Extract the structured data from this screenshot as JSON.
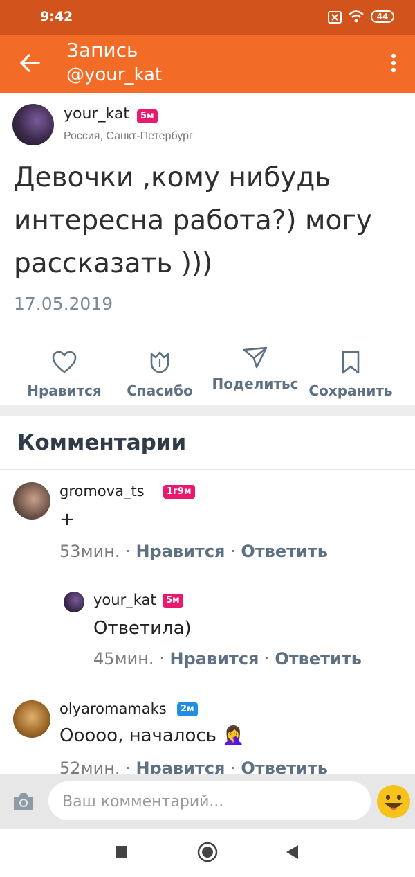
{
  "status_bar": {
    "time": "9:42",
    "battery": "44"
  },
  "app_bar": {
    "title": "Запись",
    "subtitle": "@your_kat"
  },
  "post": {
    "author": "your_kat",
    "author_badge": "5м",
    "location": "Россия, Санкт-Петербург",
    "text": "Девочки ,кому нибудь интересна работа?) могу рассказать )))",
    "date": "17.05.2019"
  },
  "actions": [
    {
      "label": "Нравится",
      "icon": "heart-icon"
    },
    {
      "label": "Спасибо",
      "icon": "tulip-icon"
    },
    {
      "label": "Поделитьс",
      "icon": "share-icon"
    },
    {
      "label": "Сохранить",
      "icon": "bookmark-icon"
    }
  ],
  "comments_title": "Комментарии",
  "comments": [
    {
      "name": "gromova_ts",
      "badge": "1г9м",
      "text": "+",
      "time": "53мин.",
      "like": "Нравится",
      "reply": "Ответить"
    },
    {
      "name": "your_kat",
      "badge": "5м",
      "text": "Ответила)",
      "time": "45мин.",
      "like": "Нравится",
      "reply": "Ответить"
    },
    {
      "name": "olyaromamaks",
      "badge": "2м",
      "text": "Ооооо, началось 🤦‍♀️",
      "time": "52мин.",
      "like": "Нравится",
      "reply": "Ответить"
    }
  ],
  "comment_input": {
    "placeholder": "Ваш комментарий..."
  },
  "colors": {
    "status": "#d2541c",
    "appbar": "#f26b27",
    "badge_pink": "#e8196e",
    "badge_blue": "#1f8ee3",
    "action": "#5d7183"
  }
}
